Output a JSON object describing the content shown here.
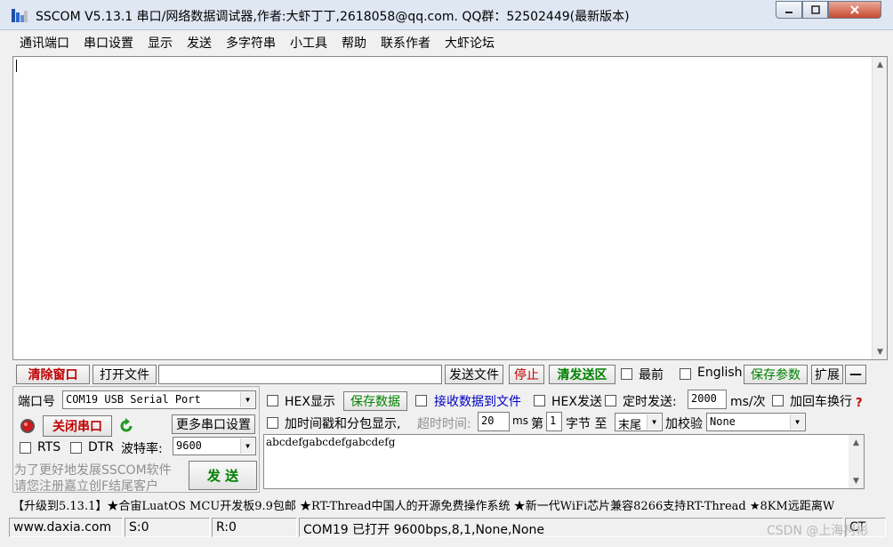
{
  "window": {
    "title": "SSCOM V5.13.1 串口/网络数据调试器,作者:大虾丁丁,2618058@qq.com. QQ群：52502449(最新版本)"
  },
  "menu": [
    "通讯端口",
    "串口设置",
    "显示",
    "发送",
    "多字符串",
    "小工具",
    "帮助",
    "联系作者",
    "大虾论坛"
  ],
  "receive": {
    "content": ""
  },
  "toolbar": {
    "clear_window": "清除窗口",
    "open_file": "打开文件",
    "file_path": "",
    "send_file": "发送文件",
    "stop": "停止",
    "clear_send": "清发送区",
    "topmost": "最前",
    "english": "English",
    "save_params": "保存参数",
    "expand": "扩展",
    "collapse": "—"
  },
  "port": {
    "port_label": "端口号",
    "port_value": "COM19 USB Serial Port",
    "close_port": "关闭串口",
    "more_settings": "更多串口设置",
    "rts": "RTS",
    "dtr": "DTR",
    "baud_label": "波特率:",
    "baud_value": "9600",
    "promo_line1": "为了更好地发展SSCOM软件",
    "promo_line2": "请您注册嘉立创F结尾客户"
  },
  "options": {
    "hex_display": "HEX显示",
    "save_data": "保存数据",
    "recv_to_file": "接收数据到文件",
    "hex_send": "HEX发送",
    "timed_send": "定时发送:",
    "timed_value": "2000",
    "timed_unit": "ms/次",
    "append_crlf": "加回车换行",
    "add_timestamp": "加时间戳和分包显示,",
    "timeout_label": "超时时间:",
    "timeout_value": "20",
    "timeout_unit": "ms",
    "byte_prefix": "第",
    "byte_index": "1",
    "byte_suffix": "字节 至",
    "byte_end": "末尾",
    "checksum_label": "加校验",
    "checksum_value": "None"
  },
  "send": {
    "content": "abcdefgabcdefgabcdefg",
    "button": "发 送"
  },
  "ticker": "【升级到5.13.1】★合宙LuatOS MCU开发板9.9包邮 ★RT-Thread中国人的开源免费操作系统 ★新一代WiFi芯片兼容8266支持RT-Thread ★8KM远距离W",
  "status": {
    "url": "www.daxia.com",
    "s_count": "S:0",
    "r_count": "R:0",
    "port_status": "COM19 已打开  9600bps,8,1,None,None",
    "cts": "CT"
  },
  "watermark": "CSDN @上海柯彬",
  "colors": {
    "red": "#c00000",
    "green": "#008000",
    "blue": "#0000c0"
  }
}
